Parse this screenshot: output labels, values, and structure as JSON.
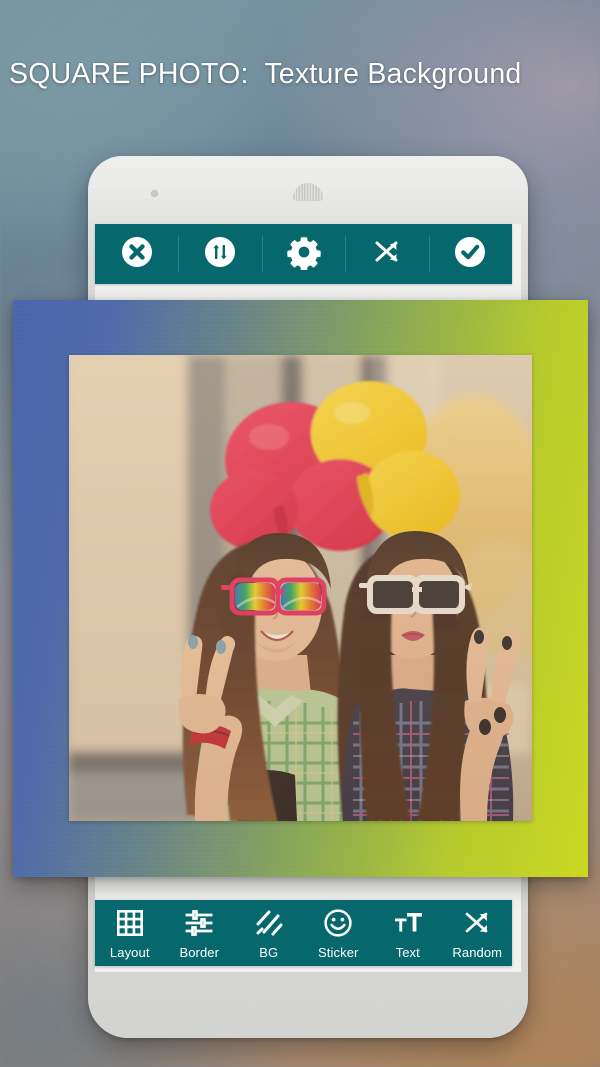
{
  "page": {
    "title": "SQUARE PHOTO:  Texture Background",
    "accent_teal": "#06686D",
    "frame_gradient_start": "#4B66AD",
    "frame_gradient_end": "#C9D821",
    "background_colors": [
      "#7FA0AE",
      "#8E8F9C",
      "#B08B6A"
    ]
  },
  "device": {
    "body_color": "#D8D8D6",
    "screen_color": "#F2F2F0",
    "camera_label": "front-camera",
    "speaker_label": "earpiece-speaker"
  },
  "top_toolbar": {
    "items": [
      {
        "id": "close",
        "icon": "close-circle-icon",
        "label": "Close"
      },
      {
        "id": "swap",
        "icon": "swap-vertical-icon",
        "label": "Swap"
      },
      {
        "id": "settings",
        "icon": "gear-icon",
        "label": "Settings"
      },
      {
        "id": "shuffle",
        "icon": "shuffle-icon",
        "label": "Shuffle"
      },
      {
        "id": "confirm",
        "icon": "check-circle-icon",
        "label": "Confirm"
      }
    ]
  },
  "bottom_toolbar": {
    "items": [
      {
        "id": "layout",
        "icon": "grid-icon",
        "label": "Layout"
      },
      {
        "id": "border",
        "icon": "sliders-icon",
        "label": "Border"
      },
      {
        "id": "bg",
        "icon": "stripes-icon",
        "label": "BG"
      },
      {
        "id": "sticker",
        "icon": "smiley-icon",
        "label": "Sticker"
      },
      {
        "id": "text",
        "icon": "text-size-icon",
        "label": "Text"
      },
      {
        "id": "random",
        "icon": "shuffle-icon",
        "label": "Random"
      }
    ]
  },
  "collage": {
    "name": "square-photo-collage",
    "frame_style": "texture-gradient",
    "photo_alt": "Two young women outdoors with red and yellow balloons, wearing sunglasses and making peace signs"
  }
}
